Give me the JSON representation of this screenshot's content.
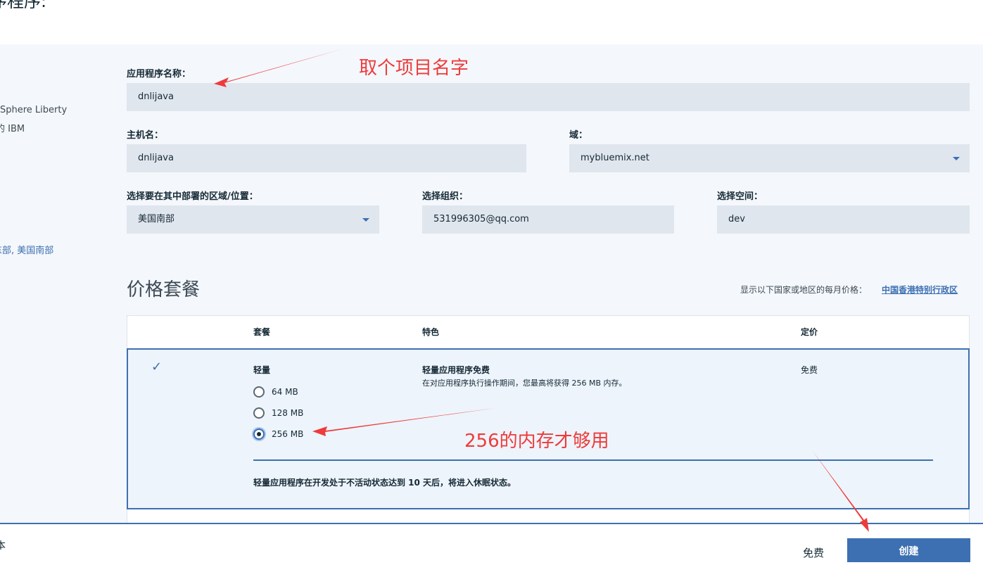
{
  "page": {
    "title_fragment": "序程序:"
  },
  "sidebar": {
    "line1": "Sphere Liberty",
    "line2": "的 IBM",
    "regions_link": "东部, 美国南部"
  },
  "form": {
    "app_name_label": "应用程序名称：",
    "app_name_value": "dnlijava",
    "hostname_label": "主机名：",
    "hostname_value": "dnlijava",
    "domain_label": "域：",
    "domain_value": "mybluemix.net",
    "region_label": "选择要在其中部署的区域/位置：",
    "region_value": "美国南部",
    "org_label": "选择组织：",
    "org_value": "531996305@qq.com",
    "space_label": "选择空间：",
    "space_value": "dev"
  },
  "pricing": {
    "title": "价格套餐",
    "currency_prefix": "显示以下国家或地区的每月价格：",
    "currency_link": "中国香港特别行政区",
    "headers": {
      "plan": "套餐",
      "features": "特色",
      "price": "定价"
    },
    "selected_plan": {
      "check": "✓",
      "name": "轻量",
      "feature_title": "轻量应用程序免费",
      "feature_desc": "在对应用程序执行操作期间，您最高将获得 256 MB 内存。",
      "price": "免费",
      "memory_options": [
        {
          "label": "64 MB",
          "selected": false
        },
        {
          "label": "128 MB",
          "selected": false
        },
        {
          "label": "256 MB",
          "selected": true
        }
      ],
      "note": "轻量应用程序在开发处于不活动状态达到 10 天后，将进入休眠状态。"
    }
  },
  "footer": {
    "left_fragment": "本",
    "total_price": "免费",
    "create_button": "创建"
  },
  "annotations": {
    "name_hint": "取个项目名字",
    "memory_hint": "256的内存才够用"
  },
  "colors": {
    "accent": "#3d70b2",
    "annotation": "#ee3b3b",
    "field_bg": "#e0e6ee"
  }
}
